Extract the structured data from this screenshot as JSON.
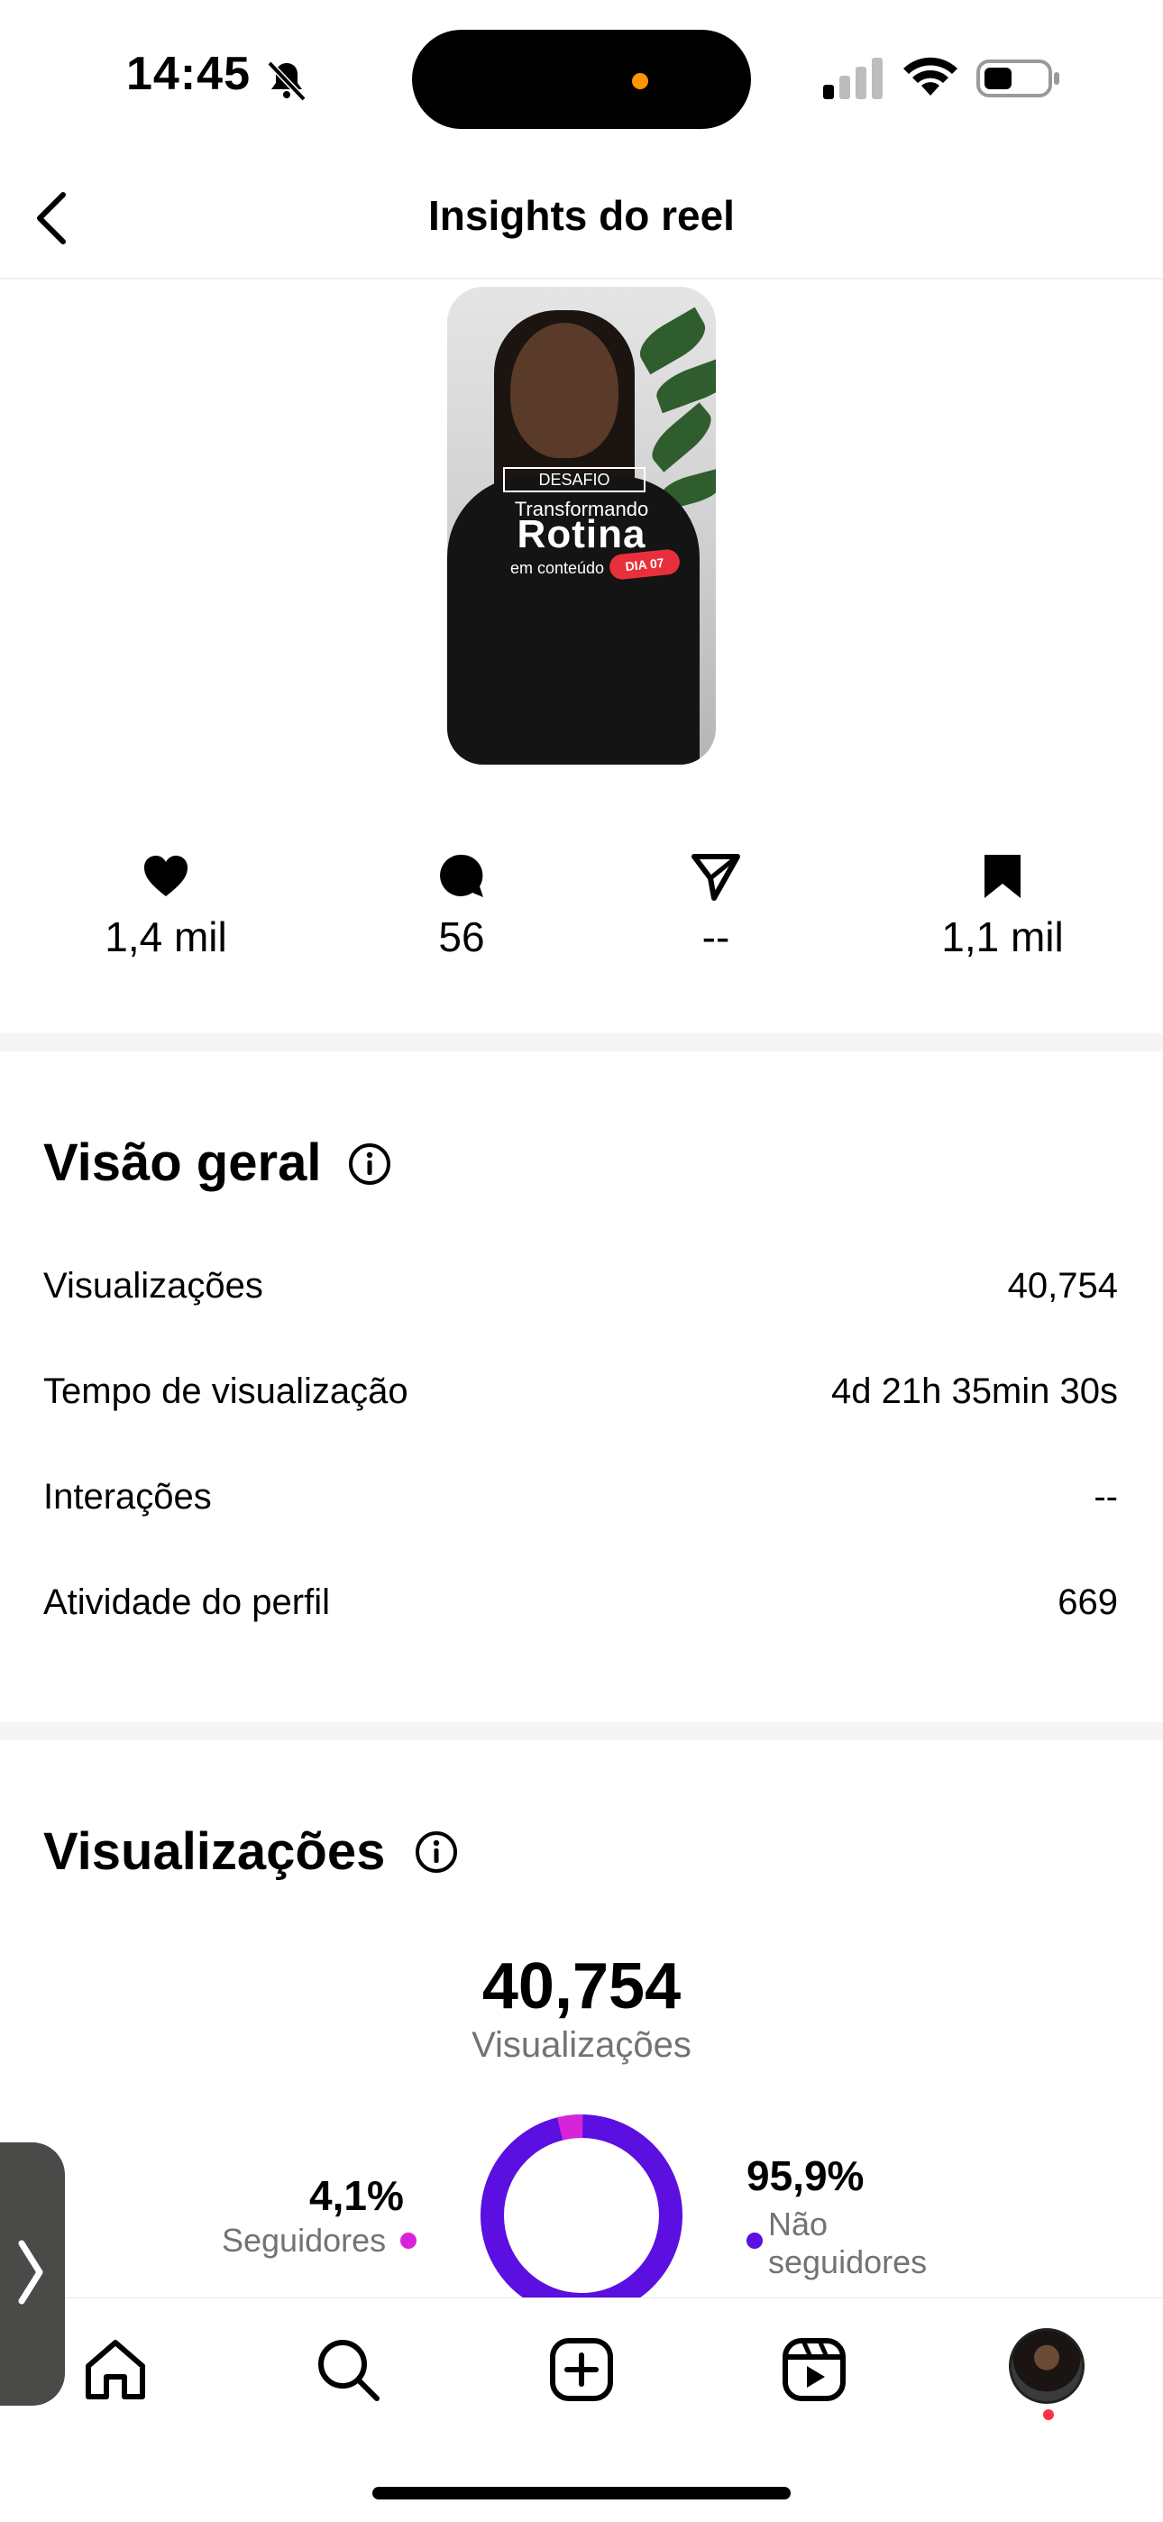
{
  "status_bar": {
    "time": "14:45"
  },
  "header": {
    "title": "Insights do reel"
  },
  "thumbnail": {
    "tag": "DESAFIO",
    "line1": "Transformando",
    "line2": "Rotina",
    "line3": "em conteúdo",
    "badge": "DIA 07"
  },
  "stats": {
    "likes": "1,4 mil",
    "comments": "56",
    "shares": "--",
    "saves": "1,1 mil"
  },
  "overview": {
    "title": "Visão geral",
    "rows": [
      {
        "label": "Visualizações",
        "value": "40,754"
      },
      {
        "label": "Tempo de visualização",
        "value": "4d 21h 35min 30s"
      },
      {
        "label": "Interações",
        "value": "--"
      },
      {
        "label": "Atividade do perfil",
        "value": "669"
      }
    ]
  },
  "views": {
    "title": "Visualizações",
    "total": "40,754",
    "total_label": "Visualizações",
    "followers_pct": "4,1%",
    "followers_label": "Seguidores",
    "followers_fraction": 0.041,
    "non_followers_pct": "95,9%",
    "non_followers_label_1": "Não",
    "non_followers_label_2": "seguidores",
    "colors": {
      "followers": "#d824d8",
      "non_followers": "#5b0fe0"
    }
  }
}
